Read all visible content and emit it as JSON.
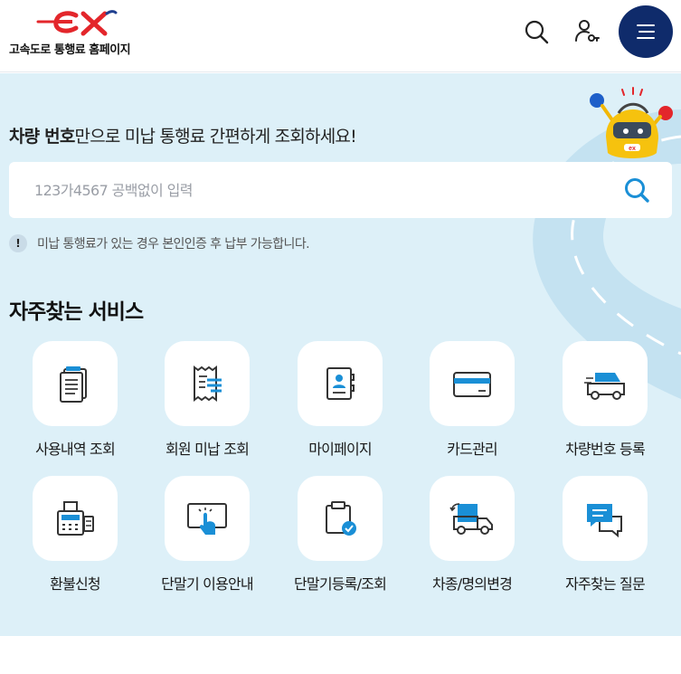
{
  "header": {
    "logo_text": "고속도로 통행료 홈페이지",
    "brand_color": "#e3262b",
    "menu_color": "#0f2b6b"
  },
  "main": {
    "headline_bold": "차량 번호",
    "headline_rest": "만으로 미납 통행료 간편하게 조회하세요!",
    "search": {
      "placeholder": "123가4567 공백없이 입력",
      "value": ""
    },
    "notice_icon": "!",
    "notice": "미납 통행료가 있는 경우 본인인증 후 납부 가능합니다.",
    "section_title": "자주찾는 서비스",
    "services": [
      {
        "label": "사용내역 조회",
        "icon": "document-list-icon"
      },
      {
        "label": "회원 미납 조회",
        "icon": "receipt-icon"
      },
      {
        "label": "마이페이지",
        "icon": "profile-book-icon"
      },
      {
        "label": "카드관리",
        "icon": "credit-card-icon"
      },
      {
        "label": "차량번호 등록",
        "icon": "truck-icon"
      },
      {
        "label": "환불신청",
        "icon": "cash-register-icon"
      },
      {
        "label": "단말기 이용안내",
        "icon": "touch-screen-icon"
      },
      {
        "label": "단말기등록/조회",
        "icon": "clipboard-check-icon"
      },
      {
        "label": "차종/명의변경",
        "icon": "vehicle-change-icon"
      },
      {
        "label": "자주찾는 질문",
        "icon": "chat-bubble-icon"
      }
    ],
    "accent_color": "#1a8fd6",
    "background_color": "#ddf0f8"
  }
}
